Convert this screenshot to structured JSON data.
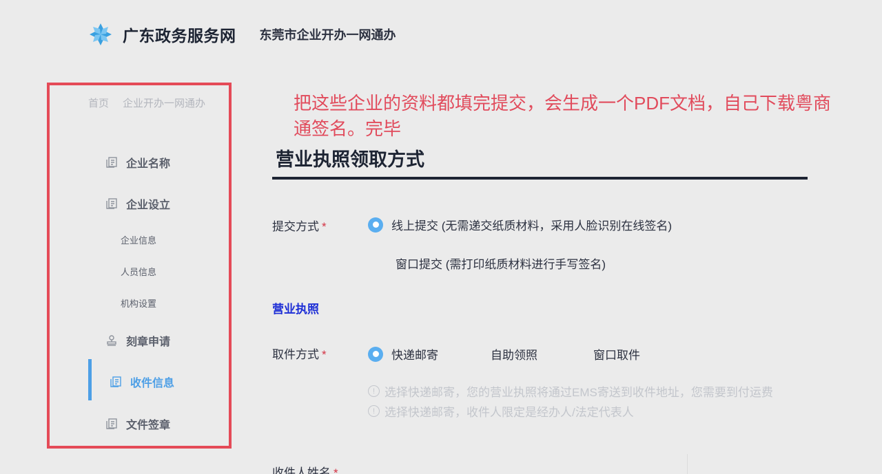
{
  "header": {
    "site_name": "广东政务服务网",
    "sub_title": "东莞市企业开办一网通办",
    "logo_icon": "pinwheel-logo"
  },
  "breadcrumb": [
    "首页",
    "企业开办一网通办"
  ],
  "sidebar": {
    "items": [
      {
        "label": "企业名称",
        "icon": "document-icon"
      },
      {
        "label": "企业设立",
        "icon": "document-icon"
      },
      {
        "label": "企业信息"
      },
      {
        "label": "人员信息"
      },
      {
        "label": "机构设置"
      },
      {
        "label": "刻章申请",
        "icon": "stamp-icon"
      },
      {
        "label": "收件信息",
        "icon": "document-icon",
        "active": true
      },
      {
        "label": "文件签章",
        "icon": "document-icon"
      }
    ]
  },
  "annotation": {
    "line1": "把这些企业的资料都填完提交，会生成一个PDF文档，自己下载粤商",
    "line2": "通签名。完毕"
  },
  "section": {
    "title": "营业执照领取方式"
  },
  "form": {
    "submit_method": {
      "label": "提交方式",
      "required_mark": "*",
      "options": [
        "线上提交 (无需递交纸质材料，采用人脸识别在线签名)",
        "窗口提交 (需打印纸质材料进行手写签名)"
      ],
      "selected": 0
    },
    "license_heading": "营业执照",
    "pickup_method": {
      "label": "取件方式",
      "required_mark": "*",
      "options": [
        "快递邮寄",
        "自助领照",
        "窗口取件"
      ],
      "selected": 0
    },
    "tips": [
      "选择快递邮寄，您的营业执照将通过EMS寄送到收件地址，您需要到付运费",
      "选择快递邮寄，收件人限定是经办人/法定代表人"
    ],
    "tip_icon": "info-icon",
    "recipient": {
      "label": "收件人姓名",
      "required_mark": "*"
    }
  },
  "colors": {
    "accent": "#4d9fe6",
    "annotation_red": "#e14b5c",
    "frame_red": "#e44a57",
    "heading_blue": "#1e2fd6"
  }
}
